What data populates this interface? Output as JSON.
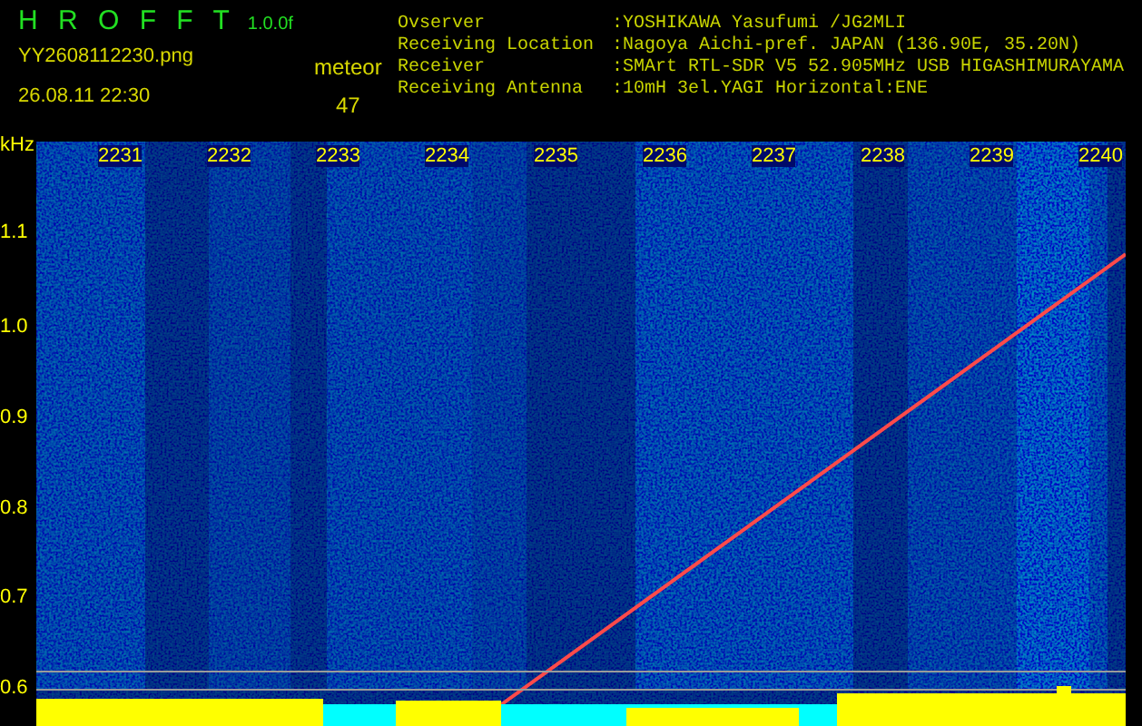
{
  "app": {
    "title": "H R O F F T",
    "version": "1.0.0f"
  },
  "file": "YY2608112230.png",
  "timestamp": "26.08.11 22:30",
  "meteor": {
    "label": "meteor",
    "count": "47"
  },
  "info": [
    {
      "label": "Ovserver",
      "value": ":YOSHIKAWA Yasufumi /JG2MLI"
    },
    {
      "label": "Receiving Location",
      "value": ":Nagoya Aichi-pref. JAPAN (136.90E, 35.20N)"
    },
    {
      "label": "Receiver",
      "value": ":SMArt RTL-SDR V5 52.905MHz USB HIGASHIMURAYAMA"
    },
    {
      "label": "Receiving Antenna",
      "value": ":10mH 3el.YAGI Horizontal:ENE"
    }
  ],
  "spectrogram": {
    "unit": "kHz",
    "y_labels": [
      "1.1",
      "1.0",
      "0.9",
      "0.8",
      "0.7",
      "0.6"
    ],
    "time_labels": [
      "2231",
      "2232",
      "2233",
      "2234",
      "2235",
      "2236",
      "2237",
      "2238",
      "2239",
      "2240"
    ]
  }
}
